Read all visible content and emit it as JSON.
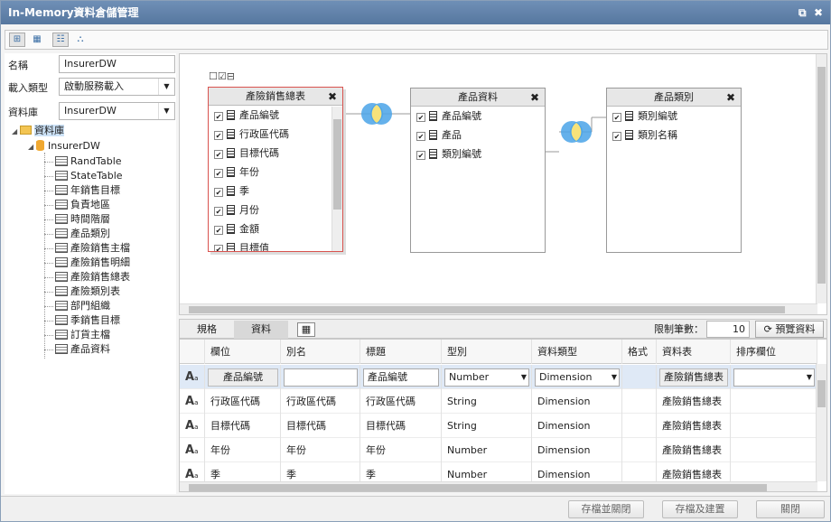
{
  "window": {
    "title": "In-Memory資料倉儲管理",
    "icons": [
      "popout-icon",
      "close-icon"
    ]
  },
  "left": {
    "name_label": "名稱",
    "name_value": "InsurerDW",
    "load_type_label": "載入類型",
    "load_type_value": "啟動服務載入",
    "database_label": "資料庫",
    "database_value": "InsurerDW",
    "tree": {
      "root": "資料庫",
      "db": "InsurerDW",
      "tables": [
        "RandTable",
        "StateTable",
        "年銷售目標",
        "負責地區",
        "時間階層",
        "產品類別",
        "產險銷售主檔",
        "產險銷售明細",
        "產險銷售總表",
        "產險類別表",
        "部門組織",
        "季銷售目標",
        "訂貨主檔",
        "產品資料"
      ]
    }
  },
  "diagram": {
    "tables": [
      {
        "title": "產險銷售總表",
        "fields": [
          "產品編號",
          "行政區代碼",
          "目標代碼",
          "年份",
          "季",
          "月份",
          "金額",
          "目標值"
        ]
      },
      {
        "title": "產品資料",
        "fields": [
          "產品編號",
          "產品",
          "類別編號"
        ]
      },
      {
        "title": "產品類別",
        "fields": [
          "類別編號",
          "類別名稱"
        ]
      }
    ]
  },
  "tabs": {
    "items": [
      "規格",
      "資料"
    ],
    "limit_label": "限制筆數：",
    "limit_value": "10",
    "preview_label": "預覽資料"
  },
  "grid": {
    "headers": [
      "欄位",
      "別名",
      "標題",
      "型別",
      "資料類型",
      "格式",
      "資料表",
      "排序欄位"
    ],
    "row_icon": "A",
    "rows": [
      {
        "field": "產品編號",
        "alias": "",
        "title": "產品編號",
        "type": "Number",
        "dtype": "Dimension",
        "format": "",
        "table": "產險銷售總表",
        "sort": ""
      },
      {
        "field": "行政區代碼",
        "alias": "行政區代碼",
        "title": "行政區代碼",
        "type": "String",
        "dtype": "Dimension",
        "format": "",
        "table": "產險銷售總表",
        "sort": ""
      },
      {
        "field": "目標代碼",
        "alias": "目標代碼",
        "title": "目標代碼",
        "type": "String",
        "dtype": "Dimension",
        "format": "",
        "table": "產險銷售總表",
        "sort": ""
      },
      {
        "field": "年份",
        "alias": "年份",
        "title": "年份",
        "type": "Number",
        "dtype": "Dimension",
        "format": "",
        "table": "產險銷售總表",
        "sort": ""
      },
      {
        "field": "季",
        "alias": "季",
        "title": "季",
        "type": "Number",
        "dtype": "Dimension",
        "format": "",
        "table": "產險銷售總表",
        "sort": ""
      }
    ]
  },
  "footer": {
    "save_close": "存檔並關閉",
    "save_build": "存檔及建置",
    "close": "關閉"
  }
}
